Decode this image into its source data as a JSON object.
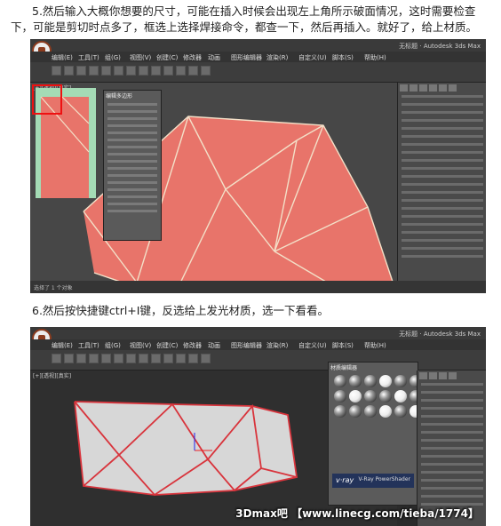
{
  "step5": {
    "text": "5.然后输入大概你想要的尺寸，可能在插入时候会出现左上角所示破面情况，这时需要检查下，可能是剪切时点多了，框选上选择焊接命令，都查一下，然后再插入。就好了，给上材质。"
  },
  "step6": {
    "text": "6.然后按快捷键ctrl+I键，反选给上发光材质，选一下看看。"
  },
  "shot1": {
    "window_title": "无标题 · Autodesk 3ds Max",
    "menus": [
      "编辑(E)",
      "工具(T)",
      "组(G)",
      "视图(V)",
      "创建(C)",
      "修改器",
      "动画",
      "图形编辑器",
      "渲染(R)",
      "自定义(U)",
      "脚本(S)",
      "帮助(H)"
    ],
    "viewport_label": "[+][透视][真实]",
    "status": "选择了 1 个对象",
    "panel_title": "编辑多边形"
  },
  "shot2": {
    "window_title": "无标题 · Autodesk 3ds Max",
    "menus": [
      "编辑(E)",
      "工具(T)",
      "组(G)",
      "视图(V)",
      "创建(C)",
      "修改器",
      "动画",
      "图形编辑器",
      "渲染(R)",
      "自定义(U)",
      "脚本(S)",
      "帮助(H)"
    ],
    "viewport_label": "[+][透视][真实]",
    "mat_editor_title": "材质编辑器",
    "vray_logo": "v·ray",
    "vray_name": "V-Ray PowerShader",
    "watermark": "3Dmax吧 【www.linecg.com/tieba/1774】"
  },
  "colors": {
    "mesh_fill": "#e8746a",
    "mesh_edge": "#f3e0c8",
    "mesh2_edge": "#d8343c",
    "thumb_green": "#a4dbb5"
  }
}
